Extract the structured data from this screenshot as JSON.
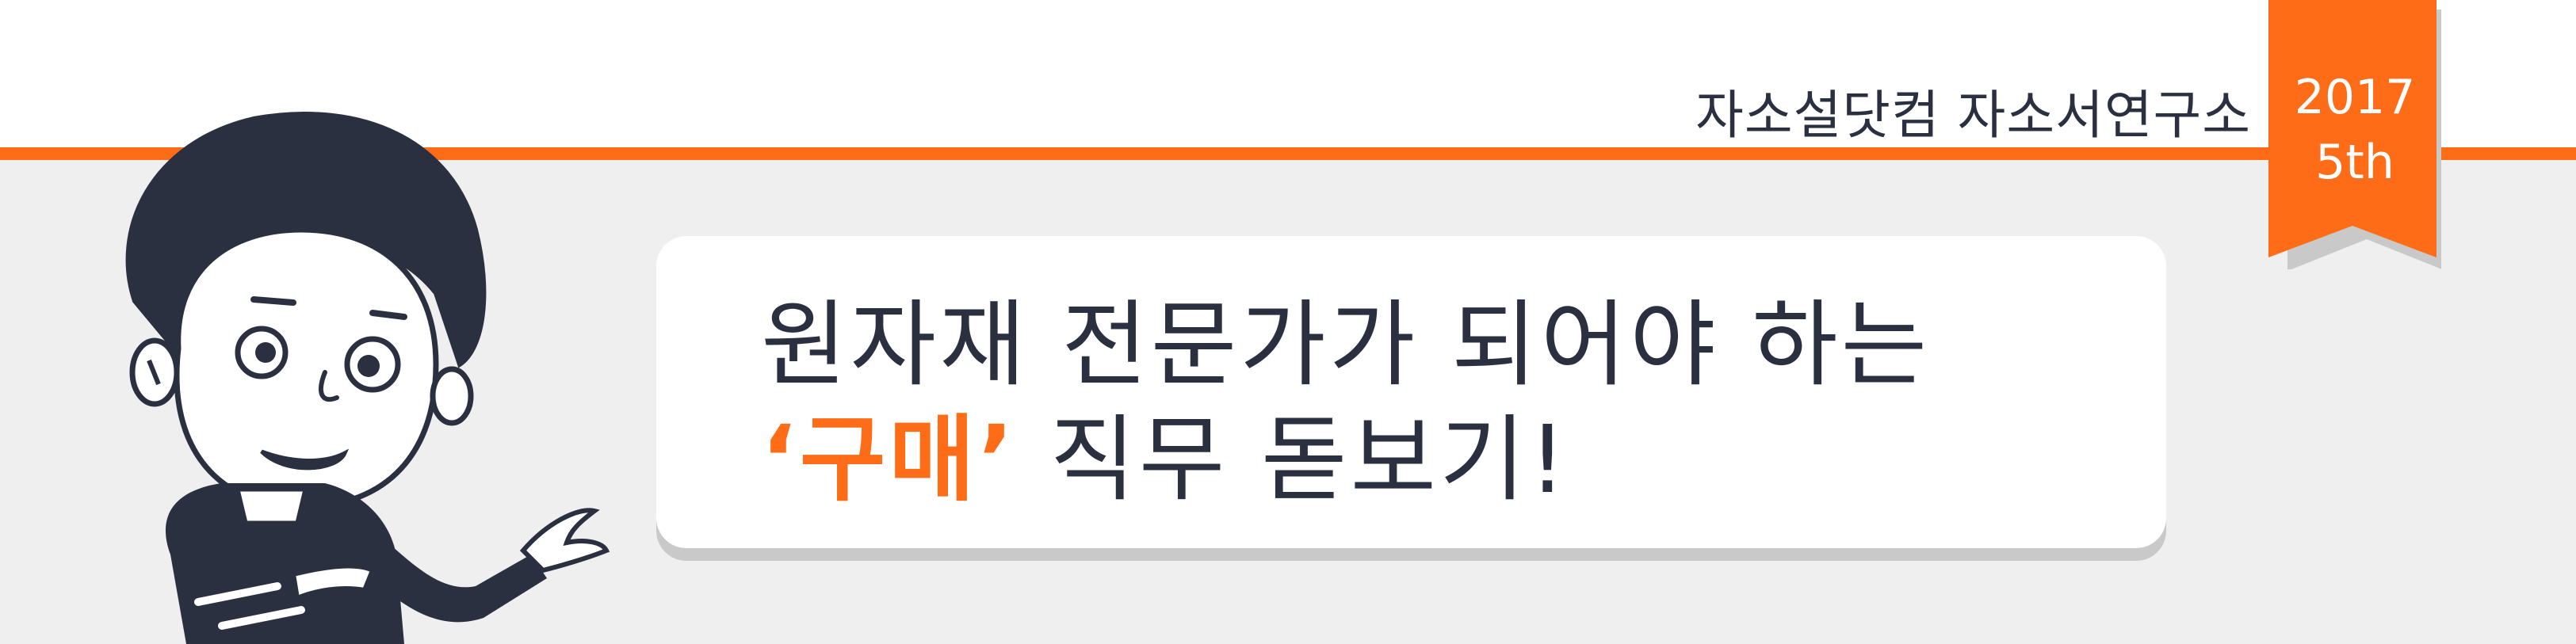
{
  "brand": {
    "title": "자소설닷컴 자소서연구소"
  },
  "badge": {
    "year": "2017",
    "edition": "5th"
  },
  "headline": {
    "line1": "원자재 전문가가 되어야 하는",
    "highlight": "‘구매’",
    "line2_rest": " 직무 돋보기!"
  },
  "colors": {
    "accent": "#ff6c17",
    "text": "#2b3040",
    "background_gray": "#efefef"
  }
}
